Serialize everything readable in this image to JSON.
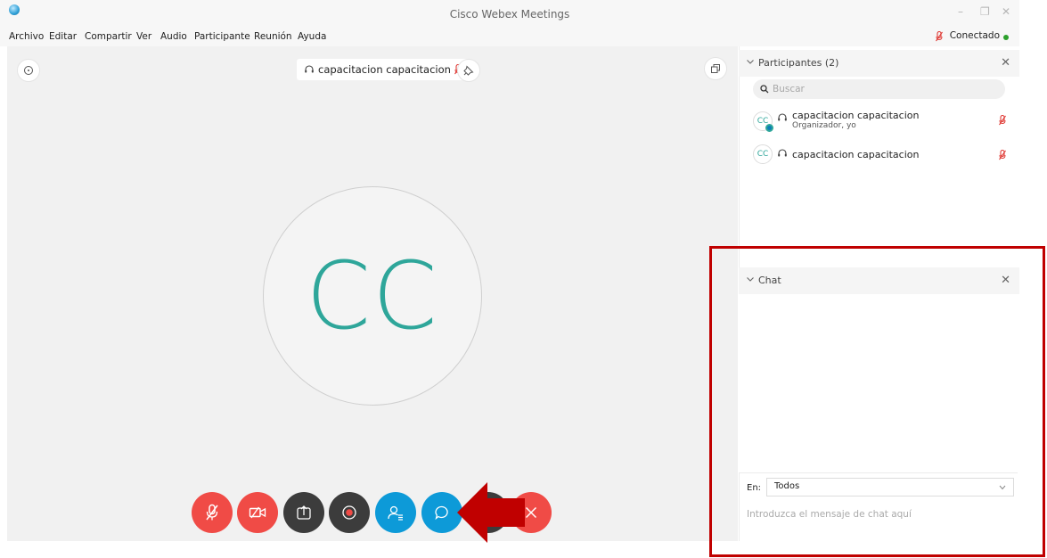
{
  "window": {
    "title": "Cisco Webex Meetings",
    "minimize_glyph": "–",
    "restore_glyph": "❐",
    "close_glyph": "✕"
  },
  "menu": {
    "items": [
      {
        "label": "Archivo"
      },
      {
        "label": "Editar"
      },
      {
        "label": "Compartir"
      },
      {
        "label": "Ver"
      },
      {
        "label": "Audio"
      },
      {
        "label": "Participante"
      },
      {
        "label": "Reunión"
      },
      {
        "label": "Ayuda"
      }
    ],
    "status": "Conectado"
  },
  "stage": {
    "speaker_name": "capacitacion capacitacion",
    "avatar_initials": "CC"
  },
  "participants": {
    "title": "Participantes (2)",
    "close_glyph": "✕",
    "search_placeholder": "Buscar",
    "list": [
      {
        "initials": "CC",
        "name": "capacitacion capacitacion",
        "role": "Organizador, yo"
      },
      {
        "initials": "CC",
        "name": "capacitacion capacitacion"
      }
    ]
  },
  "chat": {
    "title": "Chat",
    "close_glyph": "✕",
    "to_label": "En:",
    "to_value": "Todos",
    "input_placeholder": "Introduzca el mensaje de chat aquí"
  },
  "colors": {
    "accent_blue": "#0d9ad8",
    "danger_red": "#f04b46",
    "dark_button": "#3c3c3c",
    "avatar_teal": "#2ea69a",
    "highlight": "#c00000",
    "connected_green": "#2ca02c"
  },
  "icons": {
    "app": "webex-logo-icon",
    "stage_info": "info-icon",
    "stage_pin": "pin-icon",
    "stage_layout": "layout-icon",
    "speaker_headset": "headset-icon",
    "speaker_muted": "muted-mic-icon",
    "buttons": [
      "muted-mic-icon",
      "video-off-icon",
      "share-icon",
      "record-icon",
      "participants-icon",
      "chat-icon",
      "end-call-icon"
    ]
  }
}
